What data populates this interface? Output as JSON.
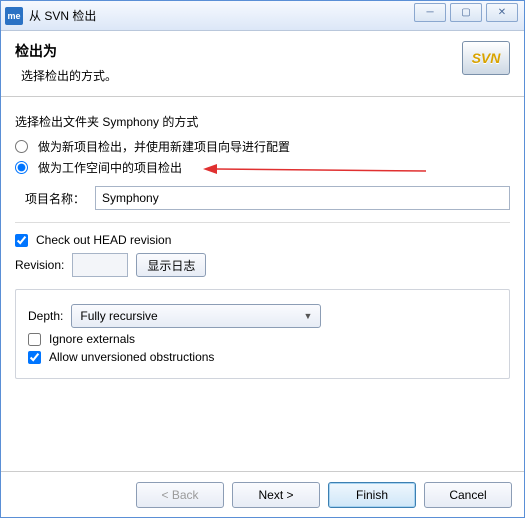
{
  "window": {
    "app_icon_text": "me",
    "title": "从 SVN 检出"
  },
  "header": {
    "title": "检出为",
    "subtitle": "选择检出的方式。",
    "badge": "SVN"
  },
  "body": {
    "prompt": "选择检出文件夹 Symphony 的方式",
    "radio1": "做为新项目检出，并使用新建项目向导进行配置",
    "radio2": "做为工作空间中的项目检出",
    "project_name_label": "项目名称：",
    "project_name_value": "Symphony",
    "head_checkbox": "Check out HEAD revision",
    "revision_label": "Revision:",
    "revision_value": "",
    "show_log_btn": "显示日志",
    "depth_label": "Depth:",
    "depth_value": "Fully recursive",
    "ignore_externals": "Ignore externals",
    "allow_unversioned": "Allow unversioned obstructions"
  },
  "buttons": {
    "back": "< Back",
    "next": "Next >",
    "finish": "Finish",
    "cancel": "Cancel"
  }
}
